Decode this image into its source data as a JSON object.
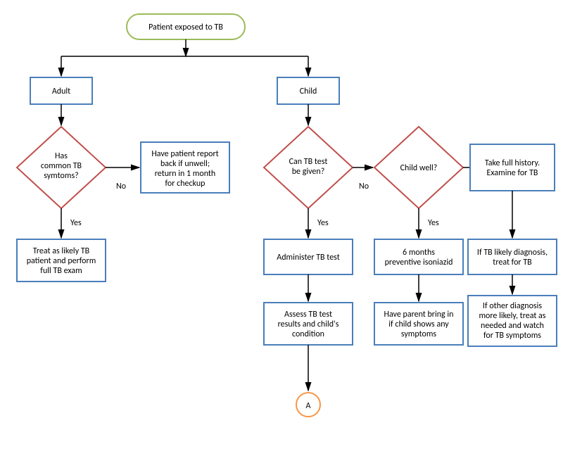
{
  "start": "Patient exposed to TB",
  "adult": "Adult",
  "child": "Child",
  "d1_l1": "Has",
  "d1_l2": "common TB",
  "d1_l3": "symtoms?",
  "r1_l1": "Have patient report",
  "r1_l2": "back if unwell;",
  "r1_l3": "return in 1 month",
  "r1_l4": "for checkup",
  "r2_l1": "Treat as likely TB",
  "r2_l2": "patient and perform",
  "r2_l3": "full TB exam",
  "d2_l1": "Can TB test",
  "d2_l2": "be given?",
  "d3": "Child well?",
  "r3_l1": "Take full history.",
  "r3_l2": "Examine for TB",
  "r4": "Administer TB test",
  "r5_l1": "6 months",
  "r5_l2": "preventive isoniazid",
  "r6_l1": "If TB likely diagnosis,",
  "r6_l2": "treat for TB",
  "r7_l1": "Assess TB test",
  "r7_l2": "results and child's",
  "r7_l3": "condition",
  "r8_l1": "Have parent bring in",
  "r8_l2": "if child shows any",
  "r8_l3": "symptoms",
  "r9_l1": "If other diagnosis",
  "r9_l2": "more likely, treat as",
  "r9_l3": "needed and watch",
  "r9_l4": "for TB symptoms",
  "connA": "A",
  "yes": "Yes",
  "no": "No"
}
